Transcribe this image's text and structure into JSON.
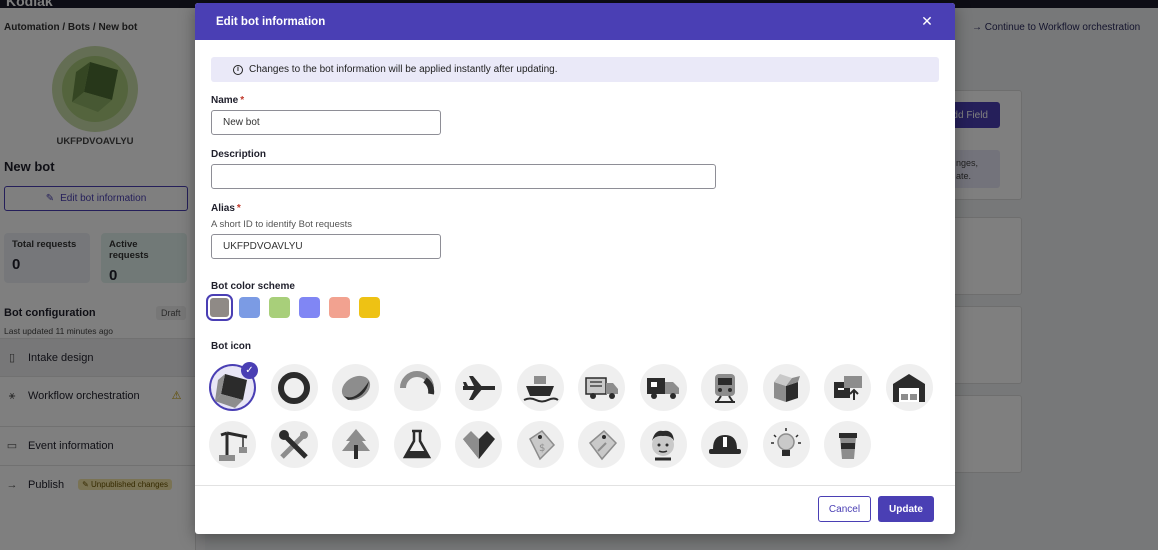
{
  "app": {
    "logo": "Kodiak",
    "breadcrumb": "Automation / Bots / New bot",
    "bot_code": "UKFPDVOAVLYU",
    "bot_name": "New bot",
    "edit_button_label": "Edit bot information",
    "stats": [
      {
        "label": "Total requests",
        "value": "0"
      },
      {
        "label": "Active requests",
        "value": "0"
      }
    ],
    "config_title": "Bot configuration",
    "config_status": "Draft",
    "config_updated": "Last updated 11 minutes ago",
    "nav": [
      {
        "label": "Intake design",
        "icon": "clipboard-icon"
      },
      {
        "label": "Workflow orchestration",
        "icon": "workflow-icon"
      },
      {
        "label": "Event information",
        "icon": "calendar-icon"
      },
      {
        "label": "Publish",
        "icon": "arrow-right-icon",
        "badge": "Unpublished changes"
      }
    ],
    "continue_link": "Continue to Workflow orchestration",
    "add_field_label": "dd Field",
    "right_note": "nges,\nate."
  },
  "modal": {
    "title": "Edit bot information",
    "info_text": "Changes to the bot information will be applied instantly after updating.",
    "name": {
      "label": "Name",
      "value": "New bot"
    },
    "description": {
      "label": "Description",
      "value": ""
    },
    "alias": {
      "label": "Alias",
      "help": "A short ID to identify Bot requests",
      "value": "UKFPDVOAVLYU"
    },
    "color_scheme": {
      "label": "Bot color scheme",
      "selected_index": 0,
      "colors": [
        "#8f8a86",
        "#7b9be4",
        "#a8cf7a",
        "#8086f4",
        "#f2a290",
        "#eec214"
      ]
    },
    "bot_icon": {
      "label": "Bot icon",
      "selected_index": 0,
      "icons": [
        "cube-icon",
        "ring-icon",
        "bowl-icon",
        "arc-icon",
        "airplane-icon",
        "ship-icon",
        "delivery-truck-icon",
        "cargo-truck-icon",
        "train-icon",
        "open-box-icon",
        "package-transfer-icon",
        "warehouse-icon",
        "crane-icon",
        "tools-icon",
        "pine-tree-icon",
        "flask-icon",
        "diamond-icon",
        "price-tag-icon",
        "discount-tag-icon",
        "person-icon",
        "hard-hat-icon",
        "lightbulb-icon",
        "coffee-cup-icon"
      ]
    },
    "cancel_label": "Cancel",
    "update_label": "Update"
  }
}
